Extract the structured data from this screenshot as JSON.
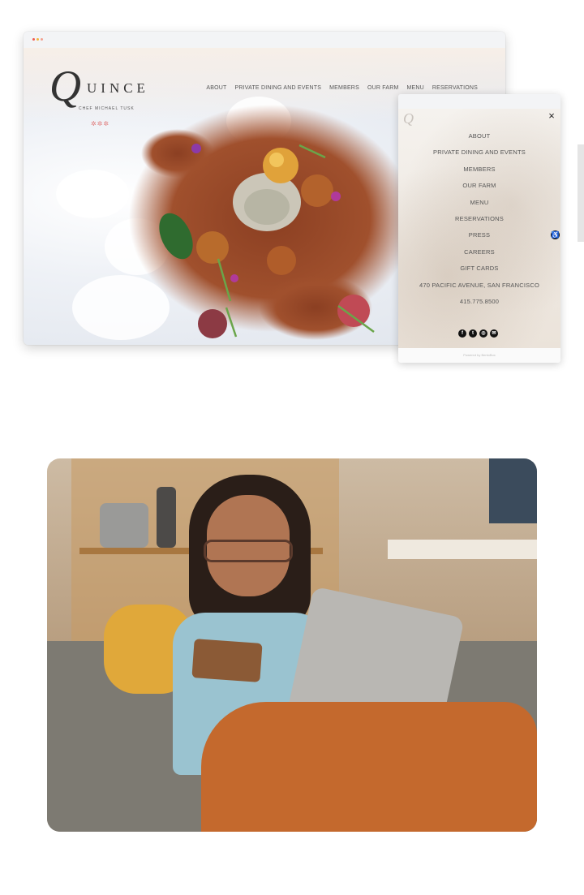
{
  "desktop_site": {
    "logo": {
      "letter": "Q",
      "word": "UINCE",
      "subtitle": "CHEF MICHAEL TUSK"
    },
    "stars": "✲✲✲",
    "nav": [
      "ABOUT",
      "PRIVATE DINING AND EVENTS",
      "MEMBERS",
      "OUR FARM",
      "MENU",
      "RESERVATIONS"
    ]
  },
  "mobile_menu": {
    "close_glyph": "×",
    "items": [
      "ABOUT",
      "PRIVATE DINING AND EVENTS",
      "MEMBERS",
      "OUR FARM",
      "MENU",
      "RESERVATIONS",
      "PRESS",
      "CAREERS",
      "GIFT CARDS",
      "470 PACIFIC AVENUE, SAN FRANCISCO",
      "415.775.8500"
    ],
    "social_icons": [
      "facebook-icon",
      "twitter-icon",
      "instagram-icon",
      "email-icon"
    ],
    "footer": "Powered by BentoBox"
  },
  "colors": {
    "star": "#e07a7a",
    "sweater": "#c4692d",
    "top": "#8fbccc"
  }
}
